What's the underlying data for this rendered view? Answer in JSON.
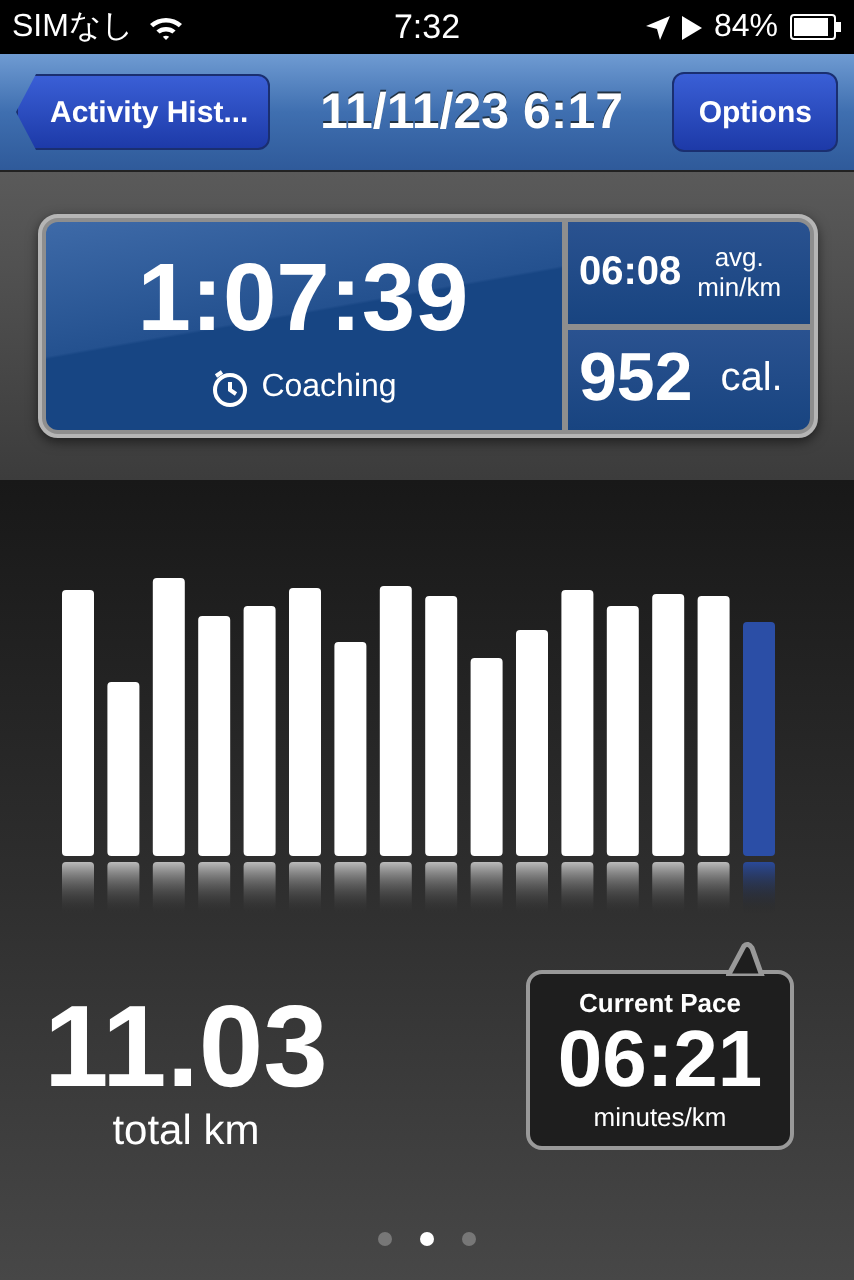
{
  "status_bar": {
    "carrier": "SIMなし",
    "time": "7:32",
    "battery": "84%"
  },
  "nav_bar": {
    "back_button": "Activity Hist...",
    "title": "11/11/23 6:17",
    "options_button": "Options"
  },
  "summary": {
    "duration": "1:07:39",
    "coaching": "Coaching",
    "avg_pace": "06:08",
    "avg_label": "avg.",
    "avg_unit": "min/km",
    "calories": "952",
    "calories_unit": "cal."
  },
  "distance": {
    "value": "11.03",
    "unit": "total km"
  },
  "current_pace": {
    "title": "Current Pace",
    "value": "06:21",
    "unit": "minutes/km"
  },
  "pages": [
    {
      "selected": false
    },
    {
      "selected": true
    },
    {
      "selected": false
    }
  ]
}
